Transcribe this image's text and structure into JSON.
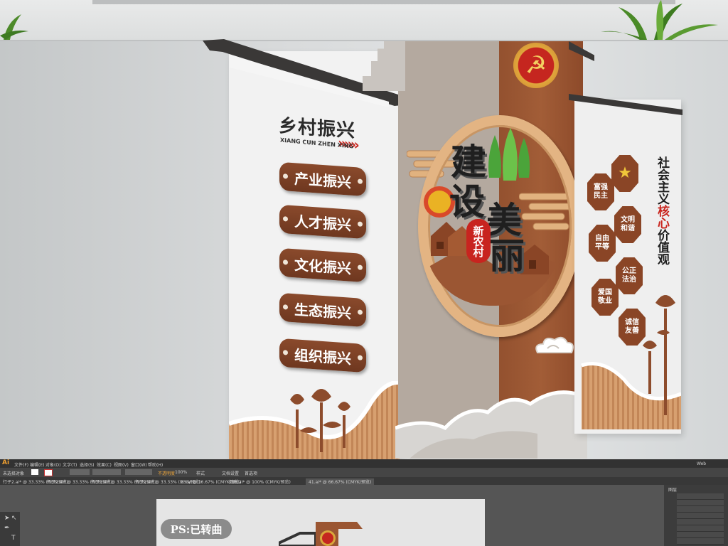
{
  "left_panel": {
    "title": "乡村振兴",
    "subtitle": "XIANG CUN ZHEN XING",
    "chevrons": "»»»",
    "plaques": [
      "产业振兴",
      "人才振兴",
      "文化振兴",
      "生态振兴",
      "组织振兴"
    ]
  },
  "center": {
    "emblem": "☭",
    "chars": [
      "建",
      "设",
      "美",
      "丽"
    ],
    "badge": "新农村"
  },
  "right_panel": {
    "heading_top": "社会主义",
    "heading_red": "核心",
    "heading_bottom": "价值观",
    "values": [
      "富强民主",
      "",
      "文明和谐",
      "自由平等",
      "公正法治",
      "爱国敬业",
      "诚信友善"
    ]
  },
  "ai_workspace": {
    "app_badge": "Ai",
    "menu_items": [
      "文件(F)",
      "编辑(E)",
      "对象(O)",
      "文字(T)",
      "选择(S)",
      "效果(C)",
      "视图(V)",
      "窗口(W)",
      "帮助(H)"
    ],
    "workspace_label": "Web",
    "control_label": "未选择对象",
    "opacity_label": "不透明度",
    "opacity_value": "100%",
    "style_label": "样式",
    "doc_setup": "文档设置",
    "prefs": "首选项",
    "tabs": [
      "行子2.ai* @ 33.33% (RGB/预览)",
      "行子2.ai* @ 33.33% (RGB/预览)",
      "行子3.ai* @ 33.33% (RGB/预览)",
      "行子2.ai* @ 33.33% (RGB/预览)",
      "23.ai @ 16.67% (CMYK/预览)",
      "倒建.ai* @ 100% (CMYK/预览)",
      "41.ai* @ 66.67% (CMYK/预览)"
    ],
    "ps_note": "PS:已转曲",
    "layers_tab": "图层"
  }
}
